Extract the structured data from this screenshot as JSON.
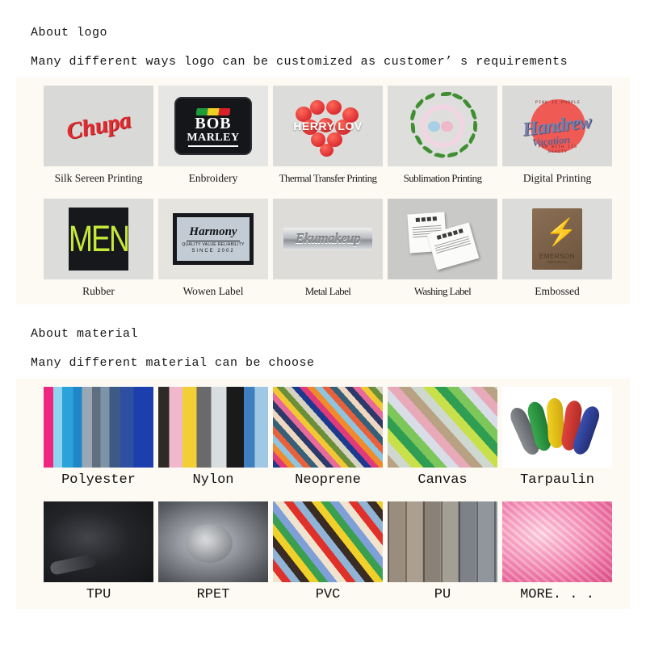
{
  "logo_section": {
    "title": "About logo",
    "subtitle": "Many different ways logo can be customized as customer’ s requirements",
    "items": [
      {
        "label": "Silk Sereen Printing",
        "art_text": "Chupa",
        "art_kind": "silk-screen-chupa"
      },
      {
        "label": "Enbroidery",
        "art_text": "BOB",
        "art_text2": "MARLEY",
        "art_kind": "embroidery-bob-marley-patch"
      },
      {
        "label": "Thermal Transfer Printing",
        "art_text": "HERRY LOV",
        "art_kind": "strawberry-heart"
      },
      {
        "label": "Sublimation Printing",
        "art_text": "",
        "art_kind": "leaf-wreath-birds"
      },
      {
        "label": "Digital Printing",
        "art_text": "Handrew",
        "art_text2": "Vacation",
        "art_kind": "digital-script-badge"
      },
      {
        "label": "Rubber",
        "art_text": "MEN",
        "art_kind": "rubber-men-patch"
      },
      {
        "label": "Wowen Label",
        "art_text": "Harmony",
        "art_text2": "QUALITY VALUE RELIABILITY",
        "art_text3": "SINCE 2002",
        "art_kind": "woven-harmony-label"
      },
      {
        "label": "Metal Label",
        "art_text": "Ekumakeup",
        "art_kind": "metal-nameplate"
      },
      {
        "label": "Washing Label",
        "art_text": "",
        "art_kind": "care-labels"
      },
      {
        "label": "Embossed",
        "art_text": "EMERSON",
        "art_text2": "IMPERIAL",
        "art_kind": "leather-embossed-patch"
      }
    ]
  },
  "material_section": {
    "title": "About material",
    "subtitle": "Many different material can be choose",
    "items": [
      {
        "label": "Polyester",
        "swatch": "vertical-strips-pink-blue"
      },
      {
        "label": "Nylon",
        "swatch": "vertical-strips-pink-yellow-black"
      },
      {
        "label": "Neoprene",
        "swatch": "diagonal-multicolor-fan"
      },
      {
        "label": "Canvas",
        "swatch": "diagonal-green-tan"
      },
      {
        "label": "Tarpaulin",
        "swatch": "colored-tarp-rolls"
      },
      {
        "label": "TPU",
        "swatch": "black-glossy-film"
      },
      {
        "label": "RPET",
        "swatch": "gray-draped-fabric"
      },
      {
        "label": "PVC",
        "swatch": "diagonal-color-sheets"
      },
      {
        "label": "PU",
        "swatch": "rolled-leatherette"
      },
      {
        "label": "MORE. . .",
        "swatch": "pink-plush-fur"
      }
    ]
  },
  "colors": {
    "panel_background": "#fdfaf4",
    "page_background": "#ffffff",
    "text": "#161616"
  }
}
